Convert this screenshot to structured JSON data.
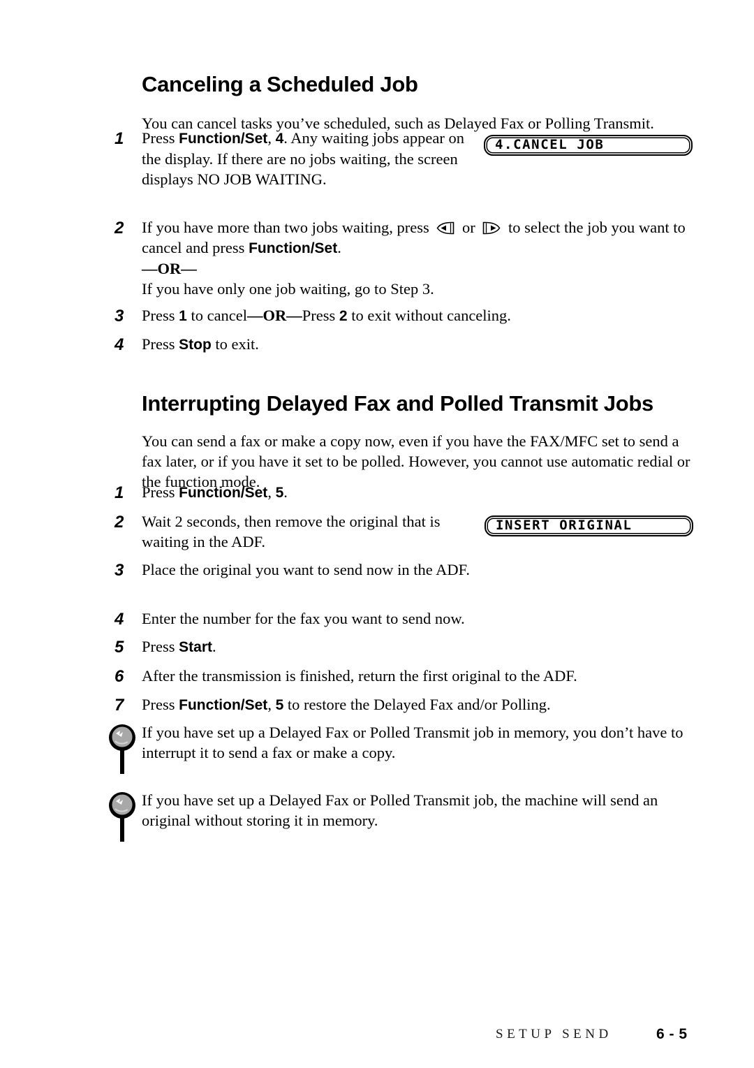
{
  "document": {
    "sections": [
      {
        "heading": "Canceling a Scheduled Job",
        "intro": "You can cancel tasks you’ve scheduled, such as Delayed Fax or Polling Transmit.",
        "steps": [
          {
            "number": "1",
            "text_parts": [
              "Press ",
              "Function/Set",
              ", ",
              "4",
              ". Any waiting jobs appear on the display. If there are no jobs waiting, the screen displays NO JOB WAITING."
            ]
          },
          {
            "number": "2",
            "text_a": "If you have more than two jobs waiting, press ",
            "icon_left": "arrow-left-key-icon",
            "text_or": " or ",
            "icon_right": "arrow-right-key-icon",
            "text_b": " to select the job you want to cancel and press ",
            "bold_b": "Function/Set",
            "text_c": ".",
            "or_separator": "—OR—",
            "alt_text": "If you have only one job waiting, go to Step 3."
          },
          {
            "number": "3",
            "text_a": "Press ",
            "bold_a": "1",
            "text_b": " to cancel",
            "bold_or": "—OR—",
            "text_c": "Press ",
            "bold_c": "2",
            "text_d": " to exit without canceling."
          },
          {
            "number": "4",
            "text_a": "Press ",
            "bold_a": "Stop",
            "text_b": " to exit."
          }
        ],
        "lcd": "4.CANCEL JOB"
      },
      {
        "heading": "Interrupting Delayed Fax and Polled Transmit Jobs",
        "intro": "You can send a fax or make a copy now, even if you have the FAX/MFC set to send a fax later, or if you have it set to be polled. However, you cannot use automatic redial or the function mode.",
        "steps": [
          {
            "number": "1",
            "text_a": "Press ",
            "bold_a": "Function/Set",
            "text_b": ", ",
            "bold_b": "5",
            "text_c": "."
          },
          {
            "number": "2",
            "text": "Wait 2 seconds, then remove the original that is waiting in the ADF."
          },
          {
            "number": "3",
            "text": "Place the original you want to send now in the ADF."
          },
          {
            "number": "4",
            "text": "Enter the number for the fax you want to send now."
          },
          {
            "number": "5",
            "text_a": "Press ",
            "bold_a": "Start",
            "text_b": "."
          },
          {
            "number": "6",
            "text": "After the transmission is finished, return the first original to the ADF."
          },
          {
            "number": "7",
            "text_a": "Press ",
            "bold_a": "Function/Set",
            "text_b": ", ",
            "bold_b": "5",
            "text_c": " to restore the Delayed Fax and/or Polling."
          }
        ],
        "lcd": "INSERT ORIGINAL"
      }
    ],
    "notes": [
      {
        "icon": "note-pin-icon",
        "text": "If you have set up a Delayed Fax or Polled Transmit job in memory, you don’t have to interrupt it to send a fax or make a copy."
      },
      {
        "icon": "note-pin-icon",
        "text": "If you have set up a Delayed Fax or Polled Transmit job, the machine will send an original without storing it in memory."
      }
    ],
    "footer": {
      "chapter": "SETUP SEND",
      "page": "6 - 5"
    },
    "colors": {
      "text": "#000000",
      "background": "#ffffff",
      "icon_fill": "#a8a8a8"
    }
  }
}
